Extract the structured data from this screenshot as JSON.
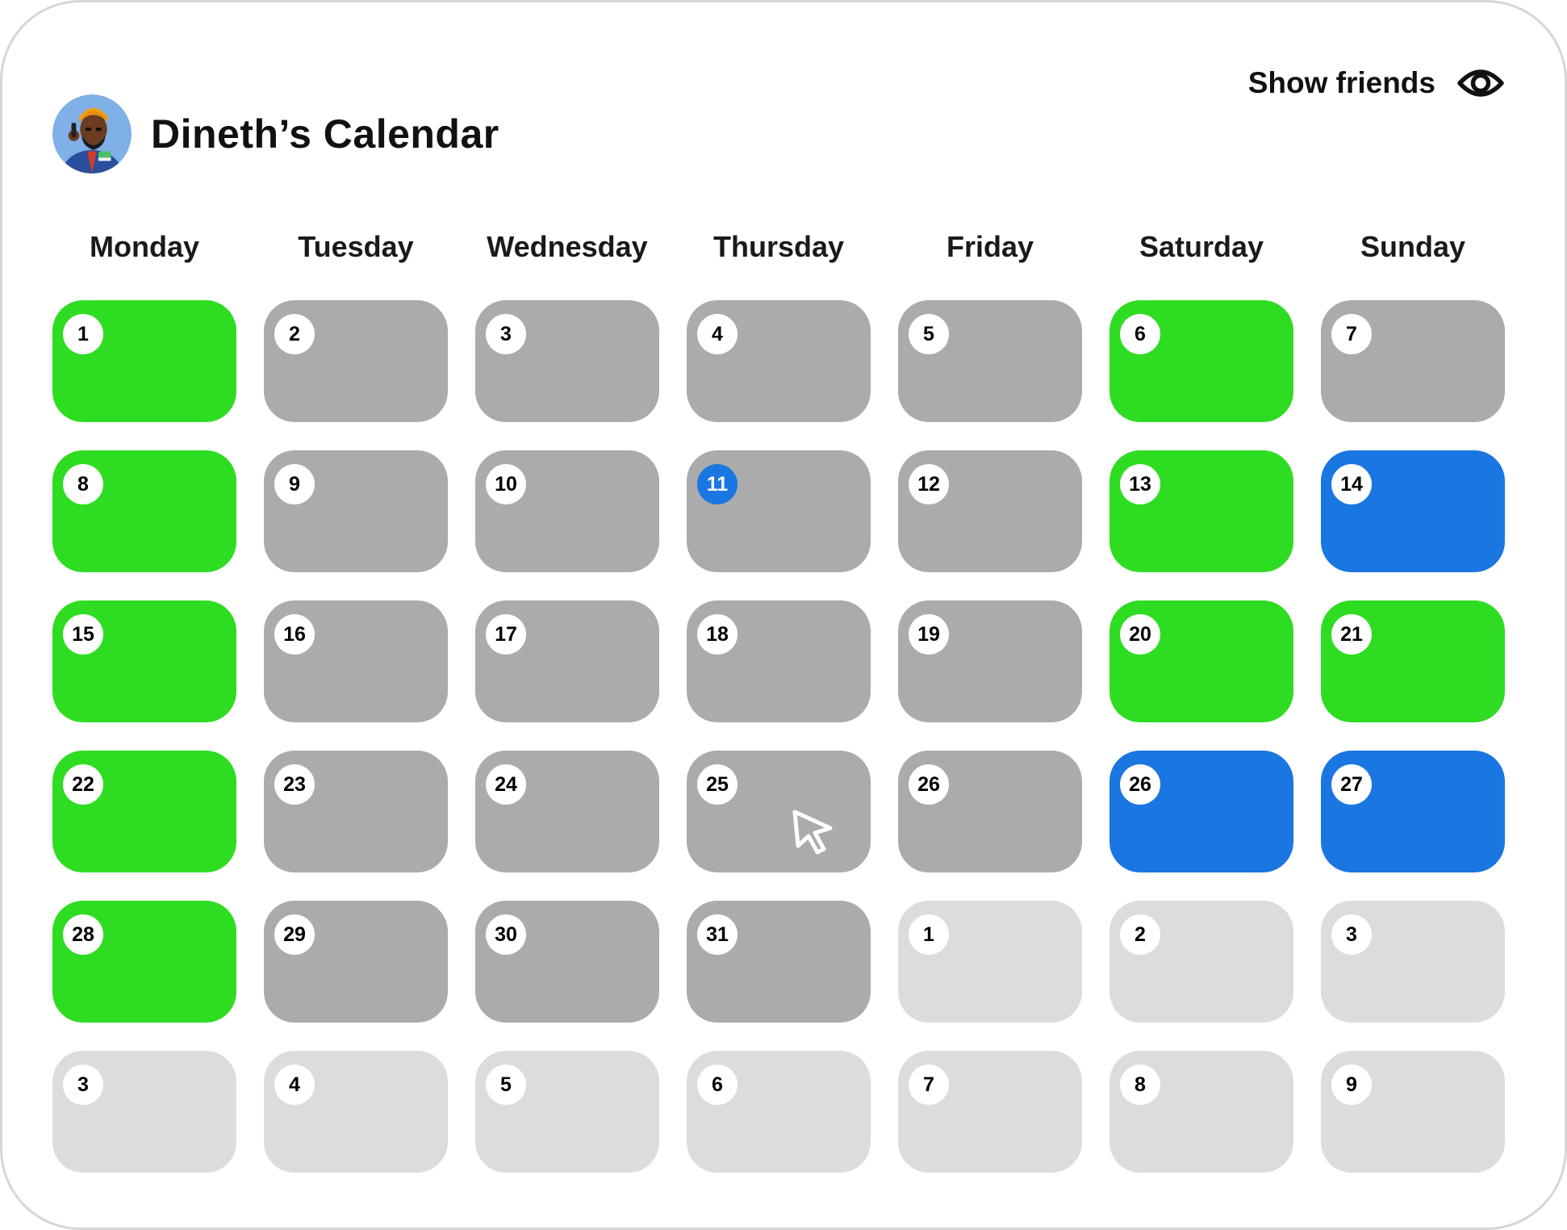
{
  "header": {
    "title": "Dineth’s Calendar",
    "show_friends_label": "Show friends"
  },
  "weekdays": [
    "Monday",
    "Tuesday",
    "Wednesday",
    "Thursday",
    "Friday",
    "Saturday",
    "Sunday"
  ],
  "colors": {
    "available": "#2edc22",
    "busy": "#ababab",
    "highlighted": "#1a76e0",
    "outside_month": "#dcdcdc",
    "today": "#1a76e0"
  },
  "days": [
    {
      "label": "1",
      "status": "green"
    },
    {
      "label": "2",
      "status": "grey"
    },
    {
      "label": "3",
      "status": "grey"
    },
    {
      "label": "4",
      "status": "grey"
    },
    {
      "label": "5",
      "status": "grey"
    },
    {
      "label": "6",
      "status": "green"
    },
    {
      "label": "7",
      "status": "grey"
    },
    {
      "label": "8",
      "status": "green"
    },
    {
      "label": "9",
      "status": "grey"
    },
    {
      "label": "10",
      "status": "grey"
    },
    {
      "label": "11",
      "status": "grey",
      "today": true
    },
    {
      "label": "12",
      "status": "grey"
    },
    {
      "label": "13",
      "status": "green"
    },
    {
      "label": "14",
      "status": "blue"
    },
    {
      "label": "15",
      "status": "green"
    },
    {
      "label": "16",
      "status": "grey"
    },
    {
      "label": "17",
      "status": "grey"
    },
    {
      "label": "18",
      "status": "grey"
    },
    {
      "label": "19",
      "status": "grey"
    },
    {
      "label": "20",
      "status": "green"
    },
    {
      "label": "21",
      "status": "green"
    },
    {
      "label": "22",
      "status": "green"
    },
    {
      "label": "23",
      "status": "grey"
    },
    {
      "label": "24",
      "status": "grey"
    },
    {
      "label": "25",
      "status": "grey",
      "cursor": true
    },
    {
      "label": "26",
      "status": "grey"
    },
    {
      "label": "26",
      "status": "blue"
    },
    {
      "label": "27",
      "status": "blue"
    },
    {
      "label": "28",
      "status": "green"
    },
    {
      "label": "29",
      "status": "grey"
    },
    {
      "label": "30",
      "status": "grey"
    },
    {
      "label": "31",
      "status": "grey"
    },
    {
      "label": "1",
      "status": "faded"
    },
    {
      "label": "2",
      "status": "faded"
    },
    {
      "label": "3",
      "status": "faded"
    },
    {
      "label": "3",
      "status": "faded"
    },
    {
      "label": "4",
      "status": "faded"
    },
    {
      "label": "5",
      "status": "faded"
    },
    {
      "label": "6",
      "status": "faded"
    },
    {
      "label": "7",
      "status": "faded"
    },
    {
      "label": "8",
      "status": "faded"
    },
    {
      "label": "9",
      "status": "faded"
    }
  ],
  "icons": {
    "avatar": "avatar-illustration",
    "show_friends": "eye-icon",
    "pointer": "mouse-cursor-icon"
  }
}
